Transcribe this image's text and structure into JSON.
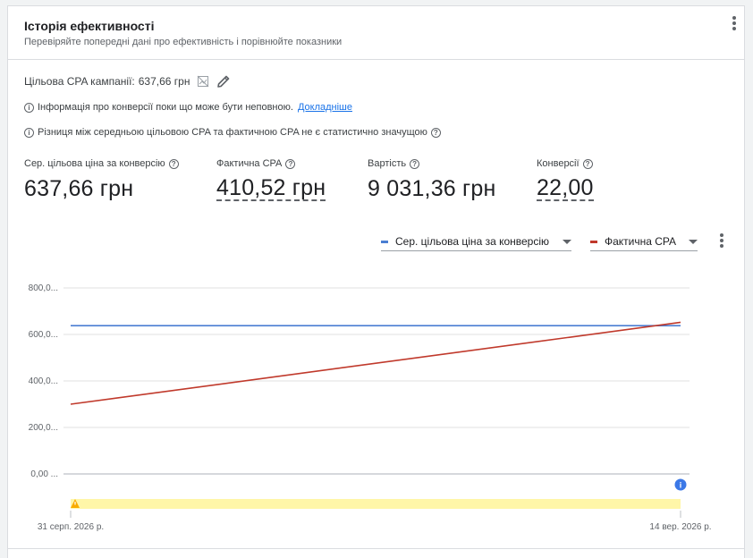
{
  "header": {
    "title": "Історія ефективності",
    "subtitle": "Перевіряйте попередні дані про ефективність і порівнюйте показники"
  },
  "target": {
    "label": "Цільова CPA кампанії:",
    "value": "637,66 грн"
  },
  "notices": {
    "conversions_text": "Інформація про конверсії поки що може бути неповною.",
    "conversions_link": "Докладніше",
    "difference_text": "Різниця між середньою цільовою CPA та фактичною CPA не є статистично значущою"
  },
  "metrics": [
    {
      "label": "Сер. цільова ціна за конверсію",
      "value": "637,66 грн"
    },
    {
      "label": "Фактична CPA",
      "value": "410,52 грн"
    },
    {
      "label": "Вартість",
      "value": "9 031,36 грн"
    },
    {
      "label": "Конверсії",
      "value": "22,00"
    }
  ],
  "legend": {
    "series1": "Сер. цільова ціна за конверсію",
    "series2": "Фактична CPA"
  },
  "colors": {
    "series1": "#4a7ed2",
    "series2": "#c0392b",
    "warning_band": "#fff6a8",
    "warning_icon": "#f9ab00",
    "info_dot": "#3b78e7"
  },
  "chart_data": {
    "type": "line",
    "x": [
      "31 серп. 2026 р.",
      "14 вер. 2026 р."
    ],
    "series": [
      {
        "name": "Сер. цільова ціна за конверсію",
        "values": [
          637.66,
          637.66
        ]
      },
      {
        "name": "Фактична CPA",
        "values": [
          300,
          652
        ]
      }
    ],
    "y_ticks": [
      "800,0...",
      "600,0...",
      "400,0...",
      "200,0...",
      "0,00 ..."
    ],
    "ylim": [
      0,
      800
    ],
    "grid": true,
    "info_marker": "i"
  }
}
